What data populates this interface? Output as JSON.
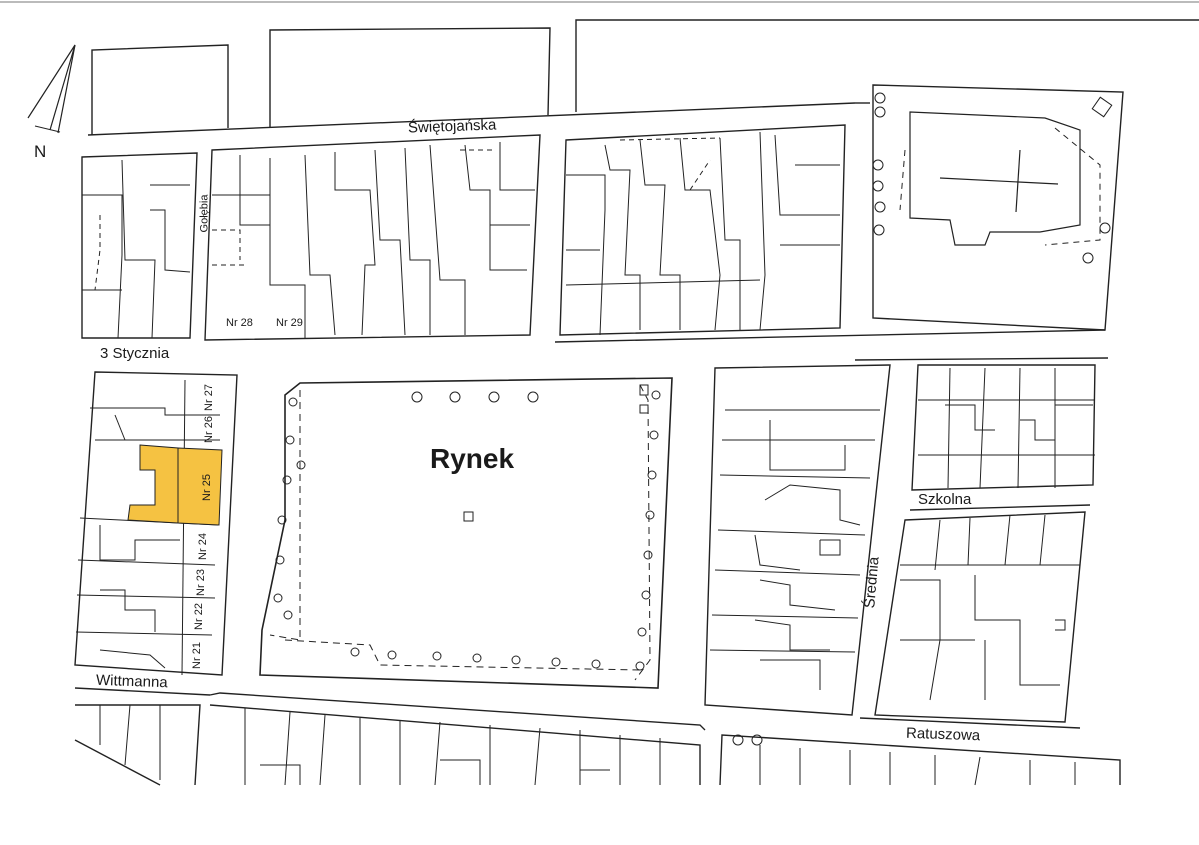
{
  "north_arrow": {
    "label": "N"
  },
  "streets": {
    "swietojanska": "Świętojańska",
    "trzeciego_stycznia": "3 Stycznia",
    "golebia": "Gołębia",
    "wittmanna": "Wittmanna",
    "szkolna": "Szkolna",
    "srednia": "Średnia",
    "ratuszowa": "Ratuszowa"
  },
  "square": {
    "name": "Rynek"
  },
  "parcels": {
    "nr28": "Nr 28",
    "nr29": "Nr 29",
    "nr27": "Nr 27",
    "nr26": "Nr 26",
    "nr25": "Nr 25",
    "nr24": "Nr 24",
    "nr23": "Nr 23",
    "nr22": "Nr 22",
    "nr21": "Nr 21"
  },
  "colors": {
    "highlight": "#f5c242",
    "line": "#222222"
  }
}
